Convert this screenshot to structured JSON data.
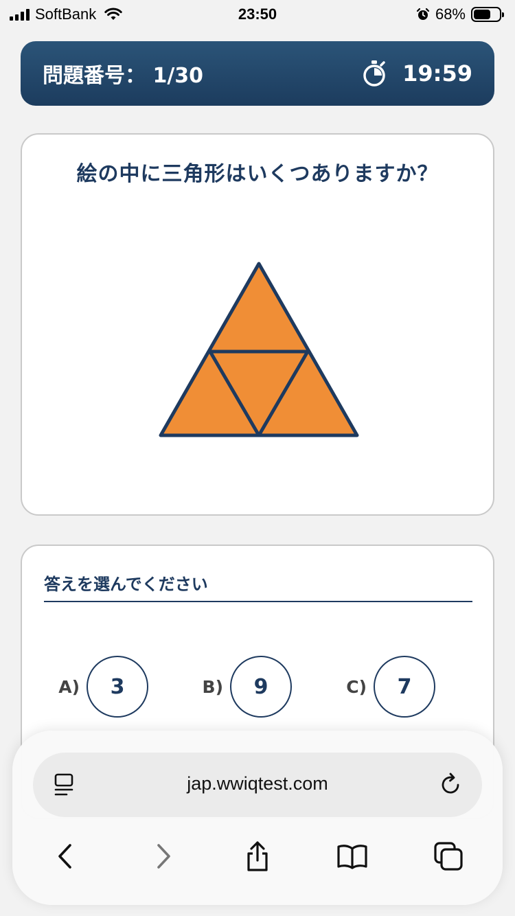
{
  "status": {
    "carrier": "SoftBank",
    "time": "23:50",
    "battery": "68%",
    "battery_level": 0.68
  },
  "header": {
    "question_label": "問題番号：",
    "question_number": "1/30",
    "timer": "19:59"
  },
  "question": {
    "text": "絵の中に三角形はいくつありますか？",
    "figure_colors": {
      "fill": "#f08e36",
      "stroke": "#1e3a5f"
    }
  },
  "answers": {
    "title": "答えを選んでください",
    "options": [
      {
        "letter": "A)",
        "value": "3"
      },
      {
        "letter": "B)",
        "value": "9"
      },
      {
        "letter": "C)",
        "value": "7"
      }
    ]
  },
  "browser": {
    "url": "jap.wwiqtest.com"
  },
  "colors": {
    "accent": "#1e3a5f",
    "header_gradient_top": "#2b5478",
    "header_gradient_bottom": "#1c3c5e",
    "triangle_fill": "#f08e36"
  }
}
